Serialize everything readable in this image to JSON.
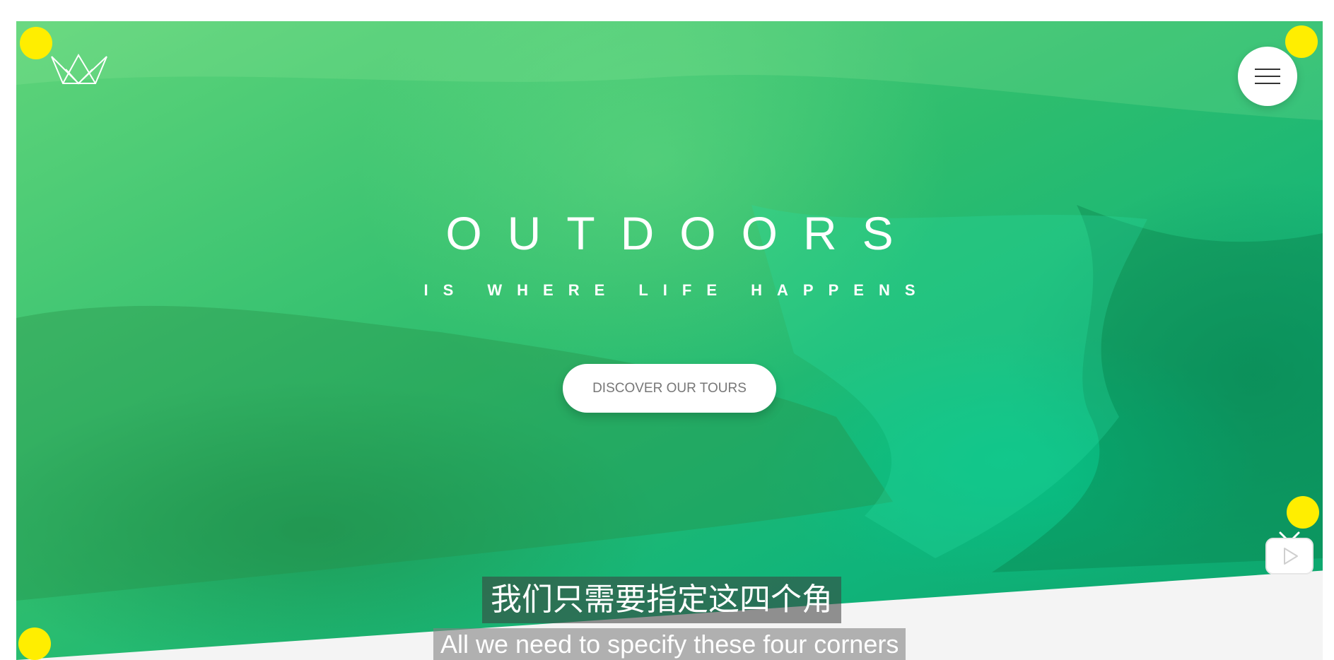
{
  "hero": {
    "title": "OUTDOORS",
    "subtitle": "IS WHERE LIFE HAPPENS",
    "cta_label": "DISCOVER OUR TOURS"
  },
  "header": {
    "logo_icon": "crown-logo-icon",
    "menu_icon": "hamburger-menu-icon"
  },
  "subtitles": {
    "zh": "我们只需要指定这四个角",
    "en": "All we need to specify these four corners"
  },
  "overlay": {
    "marker_color": "#ffee00",
    "video_icon": "tv-play-icon"
  },
  "colors": {
    "hero_green_light": "#5fd47a",
    "hero_green_dark": "#0da36a",
    "page_background": "#f4f4f4"
  }
}
